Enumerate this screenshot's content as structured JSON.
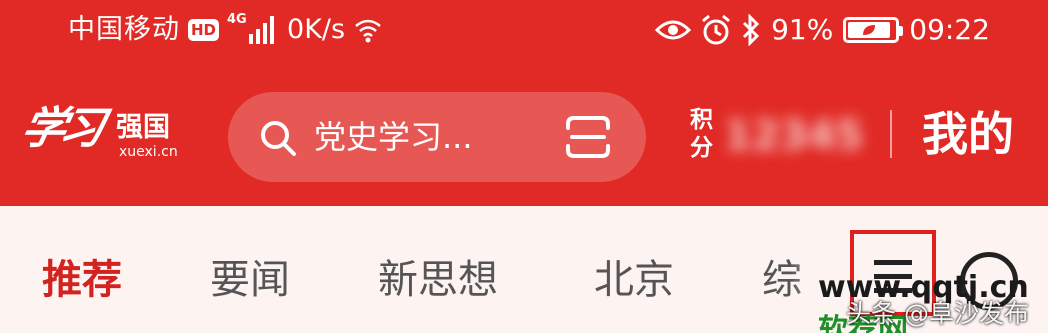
{
  "status_bar": {
    "carrier": "中国移动",
    "hd_badge": "HD",
    "network": "4G",
    "speed_text": "0K/s",
    "battery_percent": "91%",
    "battery_level": 0.91,
    "time": "09:22",
    "icons": [
      "hd-icon",
      "signal-icon",
      "wifi-icon",
      "eye-icon",
      "alarm-icon",
      "bluetooth-icon",
      "battery-icon"
    ]
  },
  "top_bar": {
    "logo_calligraphy": "学习",
    "logo_name": "强国",
    "logo_domain": "xuexi.cn",
    "search_text": "党史学习...",
    "points_label": "积分",
    "points_value": "12345",
    "mine_label": "我的"
  },
  "tabs": [
    {
      "label": "推荐",
      "active": true
    },
    {
      "label": "要闻",
      "active": false
    },
    {
      "label": "新思想",
      "active": false
    },
    {
      "label": "北京",
      "active": false
    },
    {
      "label": "综",
      "active": false
    }
  ],
  "watermark": {
    "site_prefix": "www.qqtj.cn",
    "site_suffix": "软荐网",
    "credit": "头条 @阜沙发布"
  },
  "colors": {
    "header_red": "#e12a25",
    "active_tab_red": "#d32320",
    "page_background": "#fdf3f1",
    "highlight_box": "#e0201c"
  }
}
